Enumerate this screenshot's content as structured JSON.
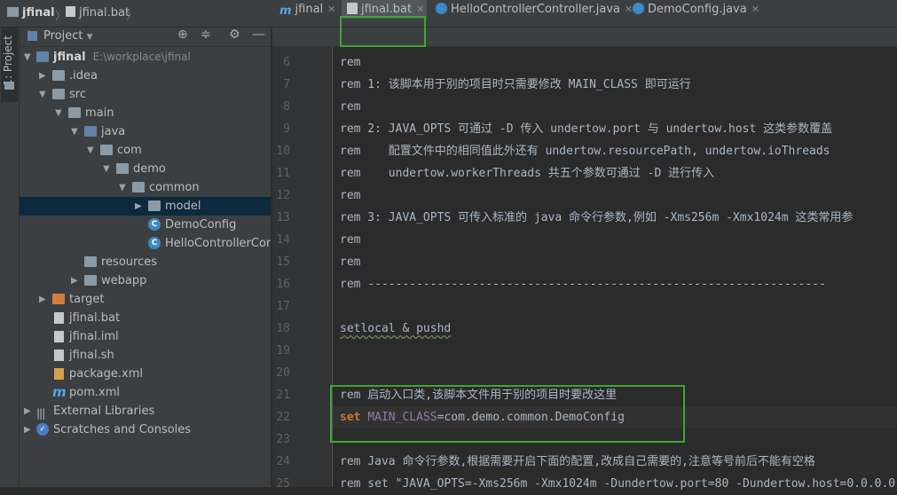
{
  "breadcrumb": {
    "project": "jfinal",
    "file": "jfinal.bat"
  },
  "stripe": {
    "label": "1: Project"
  },
  "project_panel": {
    "title": "Project",
    "tree": [
      {
        "label": "jfinal",
        "hint": "E:\\workplace\\jfinal",
        "bold": true
      },
      {
        "label": ".idea"
      },
      {
        "label": "src"
      },
      {
        "label": "main"
      },
      {
        "label": "java"
      },
      {
        "label": "com"
      },
      {
        "label": "demo"
      },
      {
        "label": "common"
      },
      {
        "label": "model"
      },
      {
        "label": "DemoConfig"
      },
      {
        "label": "HelloControllerContr"
      },
      {
        "label": "resources"
      },
      {
        "label": "webapp"
      },
      {
        "label": "target"
      },
      {
        "label": "jfinal.bat"
      },
      {
        "label": "jfinal.iml"
      },
      {
        "label": "jfinal.sh"
      },
      {
        "label": "package.xml"
      },
      {
        "label": "pom.xml"
      },
      {
        "label": "External Libraries"
      },
      {
        "label": "Scratches and Consoles"
      }
    ]
  },
  "tabs": [
    {
      "label": "jfinal"
    },
    {
      "label": "jfinal.bat"
    },
    {
      "label": "HelloControllerController.java"
    },
    {
      "label": "DemoConfig.java"
    }
  ],
  "editor": {
    "lines": [
      {
        "n": "6",
        "text": "rem"
      },
      {
        "n": "7",
        "text": "rem 1: 该脚本用于别的项目时只需要修改 MAIN_CLASS 即可运行"
      },
      {
        "n": "8",
        "text": "rem"
      },
      {
        "n": "9",
        "text": "rem 2: JAVA_OPTS 可通过 -D 传入 undertow.port 与 undertow.host 这类参数覆盖"
      },
      {
        "n": "10",
        "text": "rem    配置文件中的相同值此外还有 undertow.resourcePath, undertow.ioThreads"
      },
      {
        "n": "11",
        "text": "rem    undertow.workerThreads 共五个参数可通过 -D 进行传入"
      },
      {
        "n": "12",
        "text": "rem"
      },
      {
        "n": "13",
        "text": "rem 3: JAVA_OPTS 可传入标准的 java 命令行参数,例如 -Xms256m -Xmx1024m 这类常用参"
      },
      {
        "n": "14",
        "text": "rem"
      },
      {
        "n": "15",
        "text": "rem"
      },
      {
        "n": "16",
        "text": "rem ------------------------------------------------------------------"
      },
      {
        "n": "17",
        "text": ""
      },
      {
        "n": "18",
        "text": "setlocal & pushd"
      },
      {
        "n": "19",
        "text": ""
      },
      {
        "n": "20",
        "text": ""
      },
      {
        "n": "21",
        "text": "rem 启动入口类,该脚本文件用于别的项目时要改这里"
      },
      {
        "n": "22",
        "kw": "set",
        "var": "MAIN_CLASS",
        "rest": "=com.demo.common.DemoConfig"
      },
      {
        "n": "23",
        "text": ""
      },
      {
        "n": "24",
        "text": "rem Java 命令行参数,根据需要开启下面的配置,改成自己需要的,注意等号前后不能有空格"
      },
      {
        "n": "25",
        "text": "rem set \"JAVA_OPTS=-Xms256m -Xmx1024m -Dundertow.port=80 -Dundertow.host=0.0.0.0"
      }
    ]
  },
  "colors": {
    "highlight_box": "#3fa535",
    "selection": "#0d293e"
  }
}
